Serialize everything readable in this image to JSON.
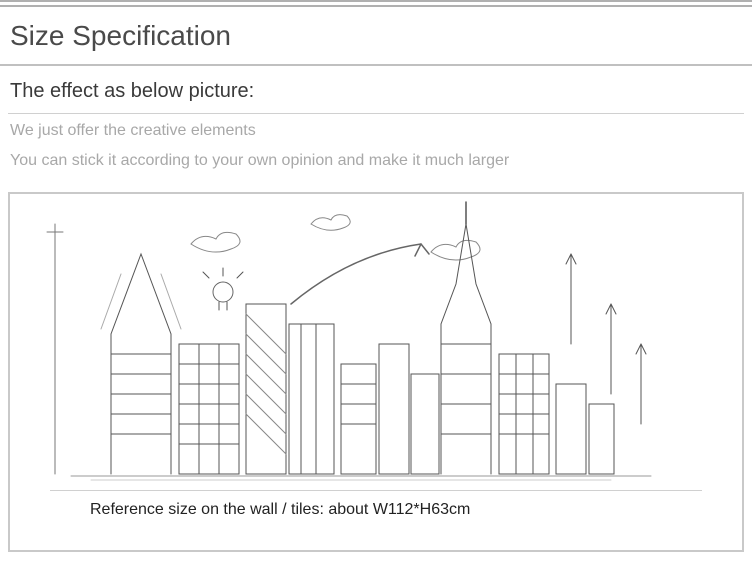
{
  "header": {
    "title": "Size Specification"
  },
  "subheader": {
    "text": "The effect as below picture:"
  },
  "notes": {
    "line1": "We just offer the creative elements",
    "line2": "You can stick it according to your own opinion and make it much larger"
  },
  "illustration": {
    "alt": "cityscape-sketch",
    "reference_size": "Reference size on the wall / tiles: about W112*H63cm"
  }
}
